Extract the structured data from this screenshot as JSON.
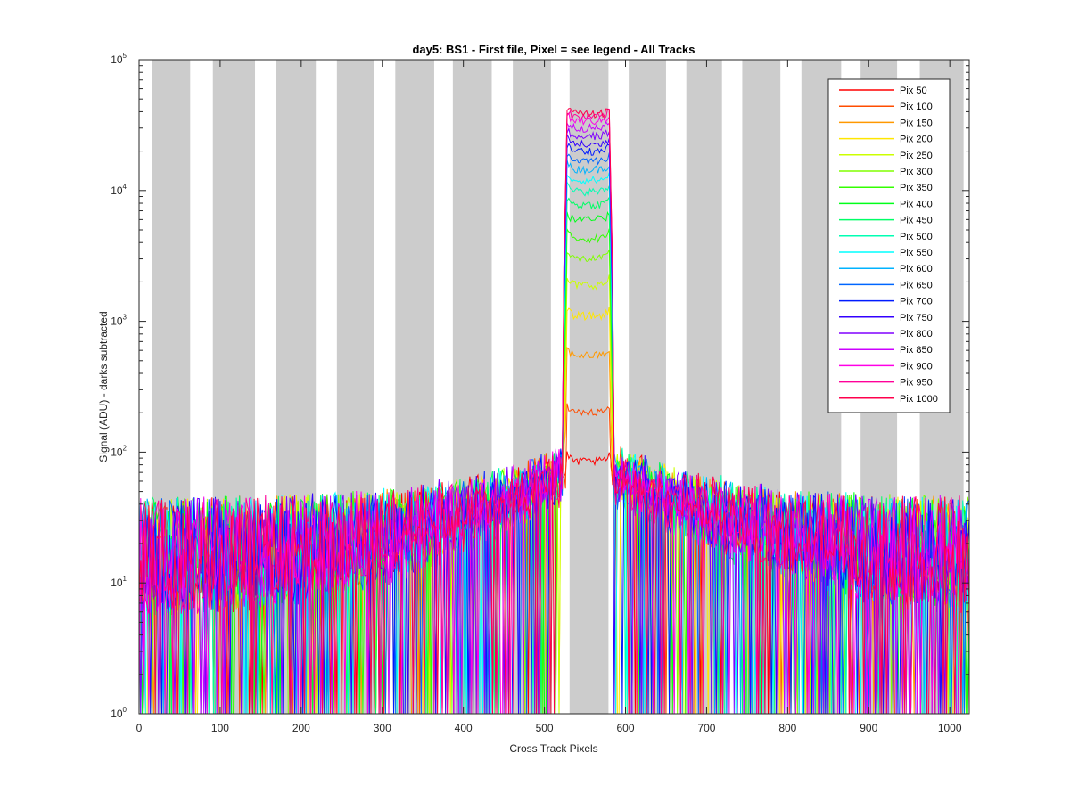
{
  "chart_data": {
    "type": "line",
    "title": "day5: BS1 - First file, Pixel = see legend - All Tracks",
    "xlabel": "Cross Track Pixels",
    "ylabel": "Signal (ADU) - darks subtracted",
    "xlim": [
      0,
      1024
    ],
    "ylim": [
      1,
      100000
    ],
    "y_scale": "log",
    "x_ticks": [
      0,
      100,
      200,
      300,
      400,
      500,
      600,
      700,
      800,
      900,
      1000
    ],
    "y_ticks": [
      {
        "value": 1,
        "base": "10",
        "exp": "0"
      },
      {
        "value": 10,
        "base": "10",
        "exp": "1"
      },
      {
        "value": 100,
        "base": "10",
        "exp": "2"
      },
      {
        "value": 1000,
        "base": "10",
        "exp": "3"
      },
      {
        "value": 10000,
        "base": "10",
        "exp": "4"
      },
      {
        "value": 100000,
        "base": "10",
        "exp": "5"
      }
    ],
    "gray_bands": [
      [
        16,
        63
      ],
      [
        91,
        143
      ],
      [
        169,
        218
      ],
      [
        244,
        290
      ],
      [
        316,
        364
      ],
      [
        387,
        435
      ],
      [
        461,
        508
      ],
      [
        531,
        579
      ],
      [
        604,
        650
      ],
      [
        675,
        719
      ],
      [
        744,
        791
      ],
      [
        817,
        866
      ],
      [
        890,
        935
      ],
      [
        963,
        1017
      ]
    ],
    "plateau_x": [
      528,
      580
    ],
    "noise_floor_ADU": 15,
    "legend_location": "top-right",
    "series": [
      {
        "name": "Pix 50",
        "color": "#ff0000",
        "plateau_level": 85
      },
      {
        "name": "Pix 100",
        "color": "#ff4d00",
        "plateau_level": 200
      },
      {
        "name": "Pix 150",
        "color": "#ff9900",
        "plateau_level": 550
      },
      {
        "name": "Pix 200",
        "color": "#ffe600",
        "plateau_level": 1100
      },
      {
        "name": "Pix 250",
        "color": "#ccff00",
        "plateau_level": 1900
      },
      {
        "name": "Pix 300",
        "color": "#80ff00",
        "plateau_level": 3000
      },
      {
        "name": "Pix 350",
        "color": "#33ff00",
        "plateau_level": 4300
      },
      {
        "name": "Pix 400",
        "color": "#00ff1a",
        "plateau_level": 6000
      },
      {
        "name": "Pix 450",
        "color": "#00ff66",
        "plateau_level": 7800
      },
      {
        "name": "Pix 500",
        "color": "#00ffb3",
        "plateau_level": 9800
      },
      {
        "name": "Pix 550",
        "color": "#00ffff",
        "plateau_level": 12000
      },
      {
        "name": "Pix 600",
        "color": "#00b3ff",
        "plateau_level": 14500
      },
      {
        "name": "Pix 650",
        "color": "#0066ff",
        "plateau_level": 17000
      },
      {
        "name": "Pix 700",
        "color": "#001aff",
        "plateau_level": 20000
      },
      {
        "name": "Pix 750",
        "color": "#3300ff",
        "plateau_level": 22500
      },
      {
        "name": "Pix 800",
        "color": "#8000ff",
        "plateau_level": 26000
      },
      {
        "name": "Pix 850",
        "color": "#cc00ff",
        "plateau_level": 30000
      },
      {
        "name": "Pix 900",
        "color": "#ff00e6",
        "plateau_level": 34000
      },
      {
        "name": "Pix 950",
        "color": "#ff0099",
        "plateau_level": 36500
      },
      {
        "name": "Pix 1000",
        "color": "#ff004d",
        "plateau_level": 38500
      }
    ]
  }
}
